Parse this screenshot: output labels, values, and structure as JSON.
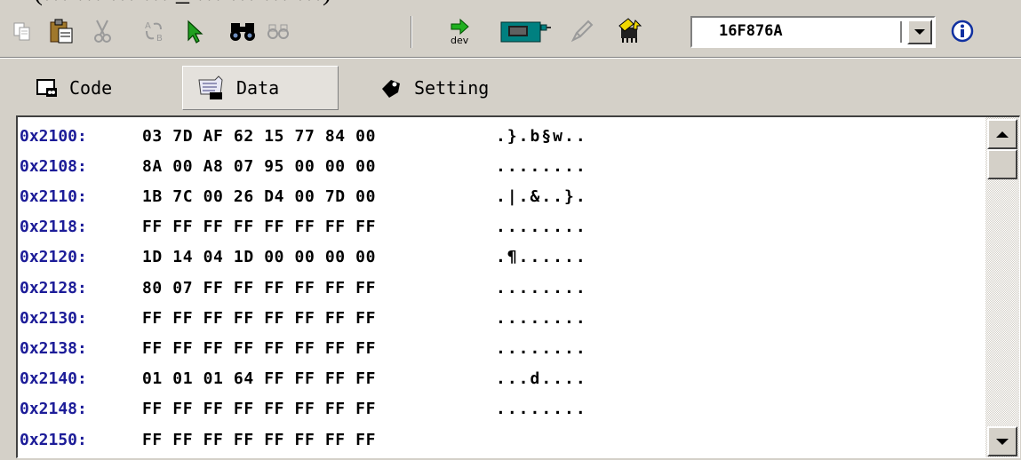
{
  "top_caption": "(… … … … _ … … … …)",
  "toolbar": {
    "icons": [
      "copy-icon",
      "paste-icon",
      "cut-icon",
      "convert-icon",
      "run-icon",
      "find-icon",
      "find-next-icon",
      "dev-arrow-icon",
      "programmer-icon",
      "pen-icon",
      "chip-insert-icon",
      "info-icon"
    ],
    "device_selected": "16F876A",
    "dev_label": "dev"
  },
  "tabs": [
    {
      "label": "Code",
      "icon": "code-tab-icon",
      "active": false
    },
    {
      "label": "Data",
      "icon": "data-tab-icon",
      "active": true
    },
    {
      "label": "Setting",
      "icon": "setting-tab-icon",
      "active": false
    }
  ],
  "hex_rows": [
    {
      "addr": "0x2100:",
      "bytes": "03 7D AF 62 15 77 84 00",
      "ascii": ".}.b§w.."
    },
    {
      "addr": "0x2108:",
      "bytes": "8A 00 A8 07 95 00 00 00",
      "ascii": "........"
    },
    {
      "addr": "0x2110:",
      "bytes": "1B 7C 00 26 D4 00 7D 00",
      "ascii": ".|.&..}."
    },
    {
      "addr": "0x2118:",
      "bytes": "FF FF FF FF FF FF FF FF",
      "ascii": "........"
    },
    {
      "addr": "0x2120:",
      "bytes": "1D 14 04 1D 00 00 00 00",
      "ascii": ".¶......"
    },
    {
      "addr": "0x2128:",
      "bytes": "80 07 FF FF FF FF FF FF",
      "ascii": "........"
    },
    {
      "addr": "0x2130:",
      "bytes": "FF FF FF FF FF FF FF FF",
      "ascii": "........"
    },
    {
      "addr": "0x2138:",
      "bytes": "FF FF FF FF FF FF FF FF",
      "ascii": "........"
    },
    {
      "addr": "0x2140:",
      "bytes": "01 01 01 64 FF FF FF FF",
      "ascii": "...d...."
    },
    {
      "addr": "0x2148:",
      "bytes": "FF FF FF FF FF FF FF FF",
      "ascii": "........"
    },
    {
      "addr": "0x2150:",
      "bytes": "FF FF FF FF FF FF FF FF",
      "ascii": ""
    }
  ],
  "colors": {
    "address": "#1c1c98",
    "face": "#d4d0c8"
  }
}
